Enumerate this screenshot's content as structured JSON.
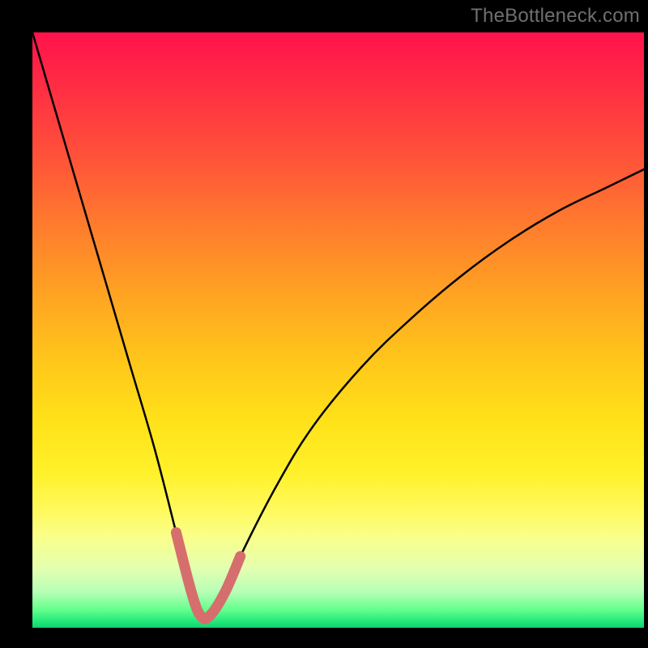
{
  "watermark": "TheBottleneck.com",
  "colors": {
    "page_bg": "#000000",
    "gradient_top": "#ff124b",
    "gradient_bottom": "#12d070",
    "curve": "#000000",
    "highlight": "#d66e6e"
  },
  "chart_data": {
    "type": "line",
    "title": "",
    "subtitle": "",
    "xlabel": "",
    "ylabel": "",
    "xlim": [
      0,
      100
    ],
    "ylim": [
      0,
      100
    ],
    "grid": false,
    "legend": false,
    "annotations": [],
    "series": [
      {
        "name": "bottleneck-curve",
        "x": [
          0,
          4,
          8,
          12,
          16,
          20,
          23.5,
          26,
          27.5,
          29,
          31.5,
          34,
          40,
          46,
          54,
          62,
          70,
          78,
          86,
          94,
          100
        ],
        "values": [
          100,
          86,
          72,
          58,
          44,
          30,
          16,
          6,
          2,
          2,
          6,
          12,
          24,
          34,
          44,
          52,
          59,
          65,
          70,
          74,
          77
        ]
      },
      {
        "name": "bottleneck-highlight",
        "x": [
          23.5,
          26,
          27.5,
          29,
          31.5,
          34
        ],
        "values": [
          16,
          6,
          2,
          2,
          6,
          12
        ]
      }
    ]
  }
}
